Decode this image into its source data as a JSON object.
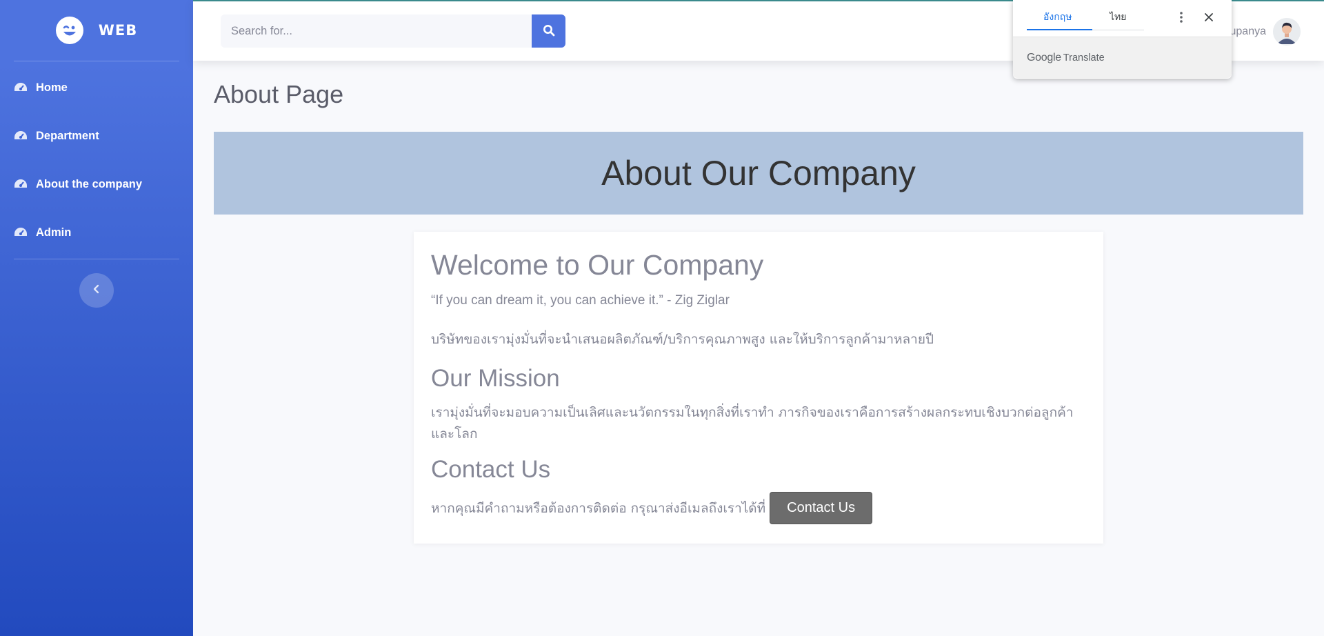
{
  "sidebar": {
    "brand": "WEB",
    "items": [
      {
        "label": "Home"
      },
      {
        "label": "Department"
      },
      {
        "label": "About the company"
      },
      {
        "label": "Admin"
      }
    ]
  },
  "topbar": {
    "search_placeholder": "Search for...",
    "user_name": "Supanya"
  },
  "translate": {
    "tab_source": "อังกฤษ",
    "tab_target": "ไทย",
    "brand_google": "Google",
    "brand_translate": "Translate"
  },
  "main": {
    "page_title": "About Page",
    "hero_title": "About Our Company",
    "welcome_title": "Welcome to Our Company",
    "quote": "“If you can dream it, you can achieve it.” - Zig Ziglar",
    "intro": "บริษัทของเรามุ่งมั่นที่จะนำเสนอผลิตภัณฑ์/บริการคุณภาพสูง และให้บริการลูกค้ามาหลายปี",
    "mission_title": "Our Mission",
    "mission_text": "เรามุ่งมั่นที่จะมอบความเป็นเลิศและนวัตกรรมในทุกสิ่งที่เราทำ ภารกิจของเราคือการสร้างผลกระทบเชิงบวกต่อลูกค้าและโลก",
    "contact_title": "Contact Us",
    "contact_text": "หากคุณมีคำถามหรือต้องการติดต่อ กรุณาส่งอีเมลถึงเราได้ที่",
    "contact_button": "Contact Us"
  },
  "colors": {
    "primary": "#4e73df",
    "hero_bg": "#b0c4de",
    "contact_button": "#6c6c6c"
  }
}
